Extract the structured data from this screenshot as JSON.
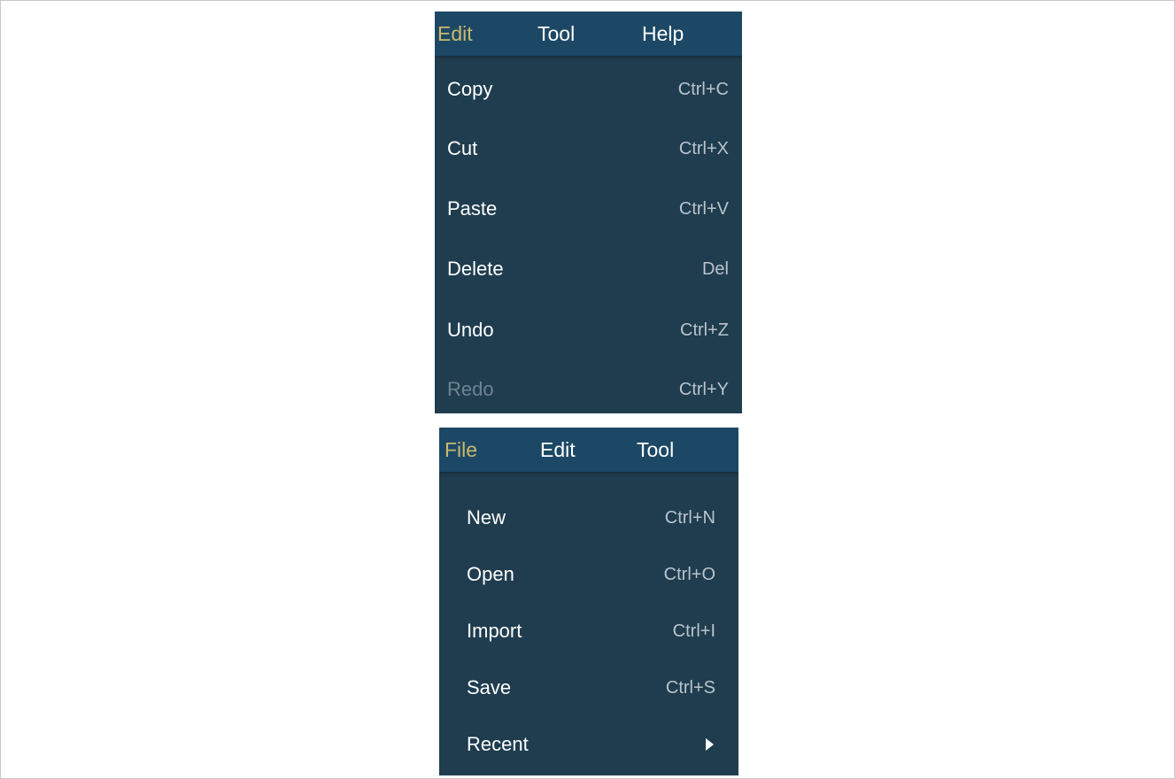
{
  "edit_menu": {
    "menubar": [
      "Edit",
      "Tool",
      "Help"
    ],
    "active": "Edit",
    "items": [
      {
        "label": "Copy",
        "shortcut": "Ctrl+C",
        "enabled": true
      },
      {
        "label": "Cut",
        "shortcut": "Ctrl+X",
        "enabled": true
      },
      {
        "label": "Paste",
        "shortcut": "Ctrl+V",
        "enabled": true
      },
      {
        "label": "Delete",
        "shortcut": "Del",
        "enabled": true
      },
      {
        "label": "Undo",
        "shortcut": "Ctrl+Z",
        "enabled": true
      },
      {
        "label": "Redo",
        "shortcut": "Ctrl+Y",
        "enabled": false
      }
    ]
  },
  "file_menu": {
    "menubar": [
      "File",
      "Edit",
      "Tool"
    ],
    "active": "File",
    "items": [
      {
        "label": "New",
        "shortcut": "Ctrl+N"
      },
      {
        "label": "Open",
        "shortcut": "Ctrl+O"
      },
      {
        "label": "Import",
        "shortcut": "Ctrl+I"
      },
      {
        "label": "Save",
        "shortcut": "Ctrl+S"
      },
      {
        "label": "Recent",
        "submenu_icon": "triangle-right-icon"
      }
    ]
  },
  "colors": {
    "menu_background": "#1f3d4f",
    "menubar_background": "#1c4866",
    "active_menubar_text": "#c9b96a",
    "text": "#ffffff",
    "shortcut_text": "#b9c4cc",
    "disabled_text": "#6f8391"
  }
}
